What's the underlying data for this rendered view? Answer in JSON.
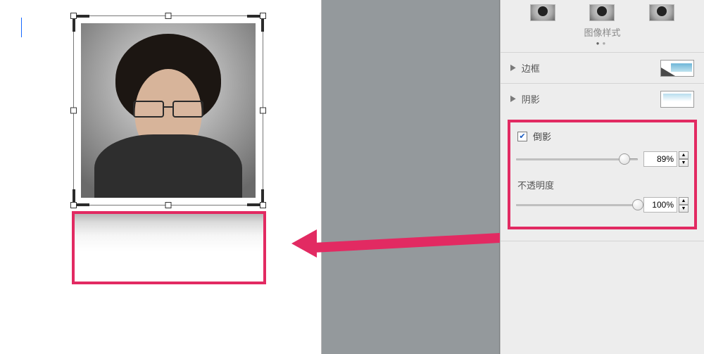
{
  "styleTitle": "图像样式",
  "rows": {
    "border": {
      "label": "边框"
    },
    "shadow": {
      "label": "阴影"
    }
  },
  "reflection": {
    "label": "倒影",
    "checked": true,
    "value": "89%",
    "percent": 89
  },
  "opacity": {
    "label": "不透明度",
    "value": "100%",
    "percent": 100
  }
}
